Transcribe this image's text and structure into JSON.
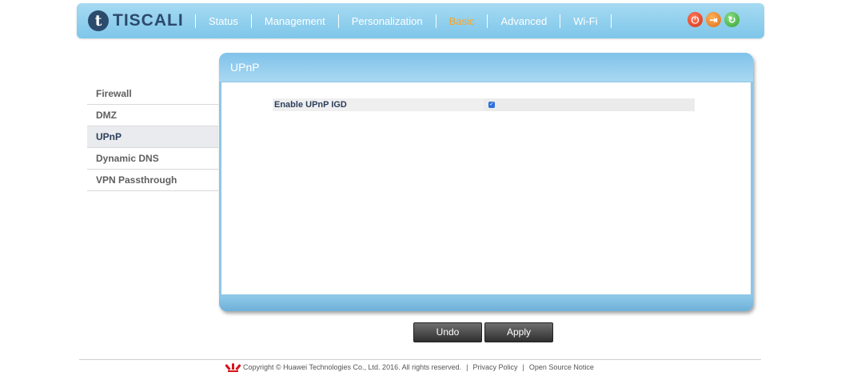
{
  "brand": {
    "name": "TISCALI",
    "initial": "t"
  },
  "nav": {
    "items": [
      "Status",
      "Management",
      "Personalization",
      "Basic",
      "Advanced",
      "Wi-Fi"
    ],
    "active": "Basic",
    "active_color": "#f5a52a"
  },
  "header_icons": [
    "power-icon",
    "logout-icon",
    "refresh-icon"
  ],
  "sidebar": {
    "items": [
      "Firewall",
      "DMZ",
      "UPnP",
      "Dynamic DNS",
      "VPN Passthrough"
    ],
    "active": "UPnP"
  },
  "panel": {
    "title": "UPnP",
    "fields": [
      {
        "label": "Enable UPnP IGD",
        "checked": true
      }
    ]
  },
  "buttons": {
    "undo": "Undo",
    "apply": "Apply"
  },
  "footer": {
    "copyright": "Copyright © Huawei Technologies Co., Ltd. 2016. All rights reserved.",
    "separator": "|",
    "privacy": "Privacy Policy",
    "open_source": "Open Source Notice"
  },
  "colors": {
    "header": "#7ec6ea",
    "accent": "#f5a52a",
    "checkbox": "#2d6fe0"
  }
}
